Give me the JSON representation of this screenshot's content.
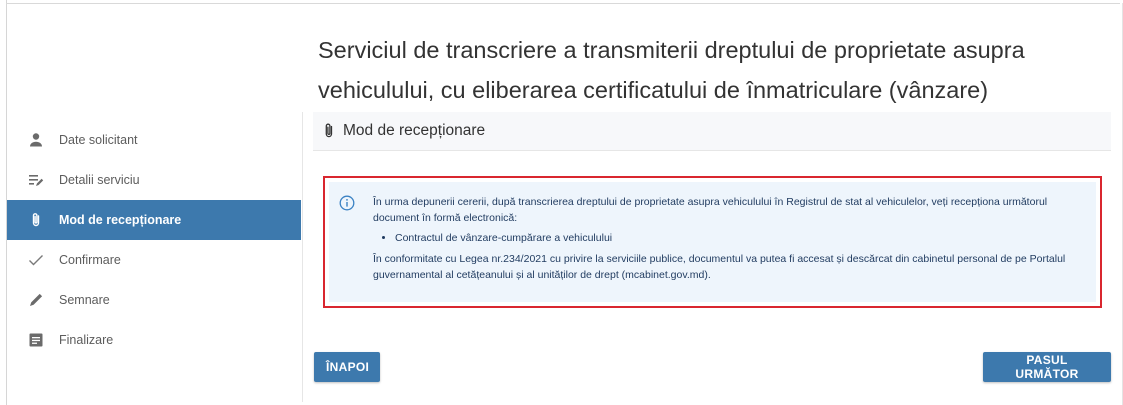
{
  "page": {
    "title": "Serviciul de transcriere a transmiterii dreptului de proprietate asupra vehiculului, cu eliberarea certificatului de înmatriculare (vânzare)"
  },
  "sidebar": {
    "items": [
      {
        "label": "Date solicitant",
        "icon": "person-icon",
        "active": false
      },
      {
        "label": "Detalii serviciu",
        "icon": "list-edit-icon",
        "active": false
      },
      {
        "label": "Mod de recepționare",
        "icon": "paperclip-icon",
        "active": true
      },
      {
        "label": "Confirmare",
        "icon": "checkmark-icon",
        "active": false
      },
      {
        "label": "Semnare",
        "icon": "pen-icon",
        "active": false
      },
      {
        "label": "Finalizare",
        "icon": "document-icon",
        "active": false
      }
    ]
  },
  "section": {
    "title": "Mod de recepționare",
    "icon": "paperclip-icon"
  },
  "info": {
    "icon": "info-icon",
    "intro": "În urma depunerii cererii, după transcrierea dreptului de proprietate asupra vehiculului în Registrul de stat al vehiculelor, veți recepționa următorul document în formă electronică:",
    "items": [
      "Contractul de vânzare-cumpărare a vehiculului"
    ],
    "note": "În conformitate cu Legea nr.234/2021 cu privire la serviciile publice, documentul va putea fi accesat și descărcat din cabinetul personal de pe Portalul guvernamental al cetățeanului și al unităților de drept (mcabinet.gov.md)."
  },
  "buttons": {
    "back": "ÎNAPOI",
    "next": "PASUL URMĂTOR"
  },
  "colors": {
    "accent": "#3d79ad",
    "highlight_border": "#d9262f",
    "info_background": "#eef5fc"
  }
}
